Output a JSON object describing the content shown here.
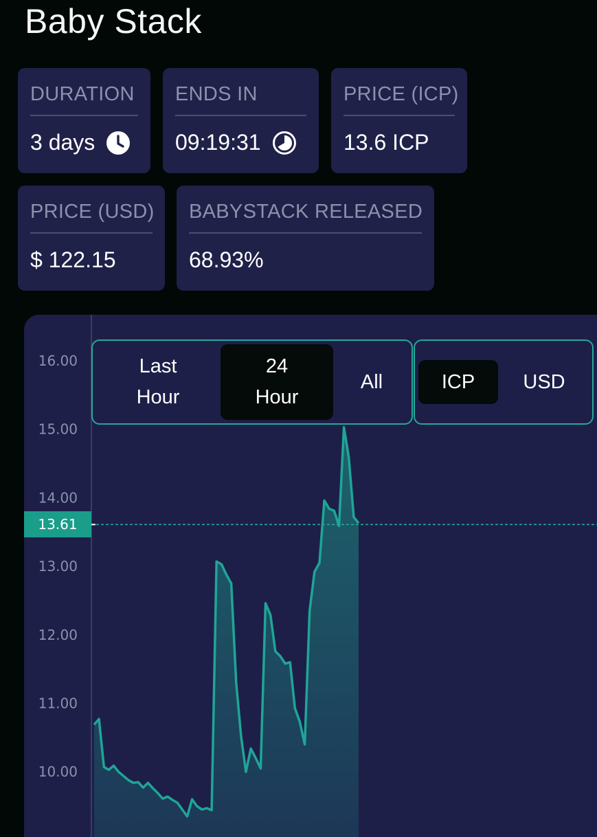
{
  "page": {
    "title": "Baby Stack"
  },
  "stats": {
    "duration": {
      "label": "DURATION",
      "value": "3 days",
      "icon": "clock-icon"
    },
    "ends_in": {
      "label": "ENDS IN",
      "value": "09:19:31",
      "icon": "pie-timer-icon"
    },
    "price_icp": {
      "label": "PRICE (ICP)",
      "value": "13.6 ICP"
    },
    "price_usd": {
      "label": "PRICE (USD)",
      "value": "$ 122.15"
    },
    "released": {
      "label": "BABYSTACK RELEASED",
      "value": "68.93%"
    }
  },
  "chart": {
    "range_buttons": [
      {
        "label": "Last\nHour",
        "active": false
      },
      {
        "label": "24\nHour",
        "active": true
      },
      {
        "label": "All",
        "active": false
      }
    ],
    "currency_buttons": [
      {
        "label": "ICP",
        "active": true
      },
      {
        "label": "USD",
        "active": false
      }
    ],
    "current_price_label": "13.61"
  },
  "colors": {
    "background": "#020806",
    "card": "#1f2149",
    "chart_panel": "#1e1f48",
    "accent": "#25a89a",
    "label": "#8c91ad"
  },
  "chart_data": {
    "type": "area",
    "title": "",
    "xlabel": "",
    "ylabel": "",
    "ylim": [
      9.24,
      16.62
    ],
    "yticks": [
      "16.00",
      "15.00",
      "14.00",
      "13.00",
      "12.00",
      "11.00",
      "10.00"
    ],
    "current_value": 13.61,
    "grid": false,
    "series": [
      {
        "values": [
          10.69,
          10.77,
          10.07,
          10.03,
          10.09,
          10.0,
          9.94,
          9.88,
          9.84,
          9.85,
          9.77,
          9.84,
          9.76,
          9.69,
          9.61,
          9.64,
          9.59,
          9.55,
          9.45,
          9.35,
          9.6,
          9.5,
          9.45,
          9.47,
          9.44,
          13.07,
          13.03,
          12.88,
          12.75,
          11.3,
          10.52,
          10.0,
          10.34,
          10.2,
          10.05,
          12.46,
          12.29,
          11.76,
          11.69,
          11.58,
          11.6,
          10.93,
          10.73,
          10.4,
          12.35,
          12.92,
          13.05,
          13.96,
          13.84,
          13.81,
          13.59,
          15.03,
          14.59,
          13.72,
          13.63
        ]
      }
    ]
  }
}
